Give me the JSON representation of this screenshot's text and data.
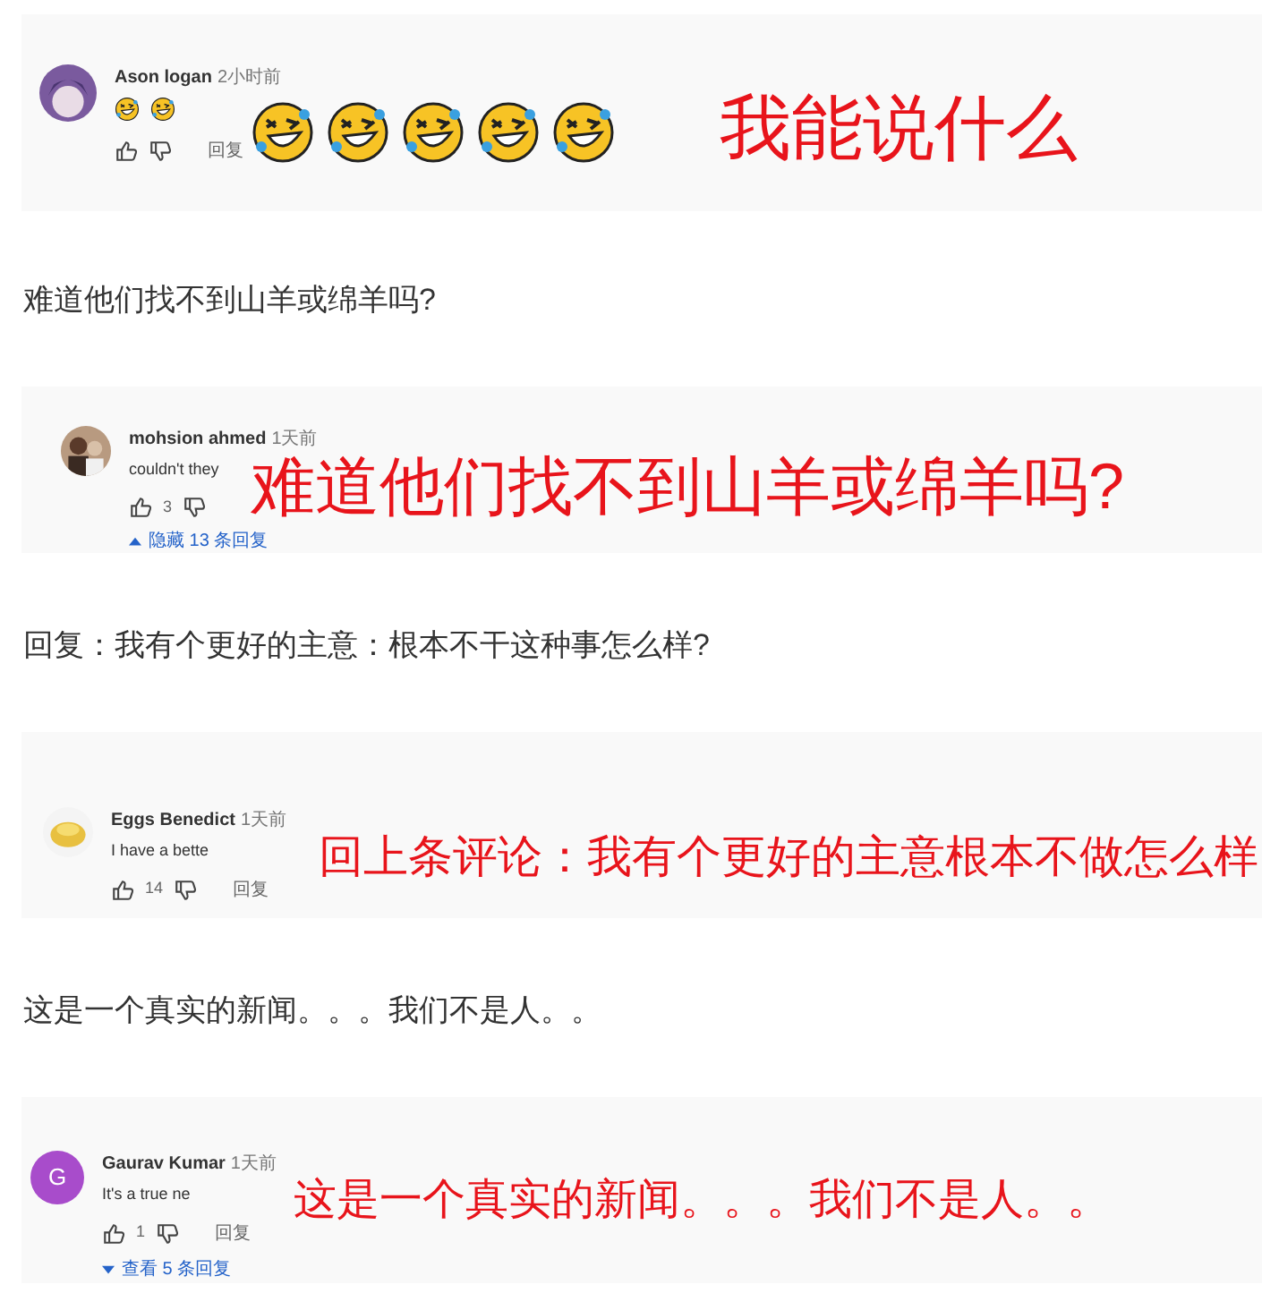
{
  "blocks": [
    {
      "kind": "comment_shot",
      "author": "Ason logan",
      "time": "2小时前",
      "body": {
        "kind": "emoji"
      },
      "reply_label": "回复",
      "caption": "我能说什么"
    },
    {
      "kind": "paragraph",
      "text": "难道他们找不到山羊或绵羊吗?"
    },
    {
      "kind": "comment_shot",
      "author": "mohsion ahmed",
      "time": "1天前",
      "body": {
        "kind": "text",
        "text": "couldn't they"
      },
      "likes": "3",
      "replies": {
        "label": "隐藏 13 条回复",
        "expanded": true
      },
      "caption": "难道他们找不到山羊或绵羊吗?"
    },
    {
      "kind": "paragraph",
      "text": "回复：我有个更好的主意：根本不干这种事怎么样?"
    },
    {
      "kind": "comment_shot",
      "author": "Eggs Benedict",
      "time": "1天前",
      "body": {
        "kind": "text",
        "text": "I have a bette"
      },
      "likes": "14",
      "reply_label": "回复",
      "caption": "回上条评论：我有个更好的主意根本不做怎么样"
    },
    {
      "kind": "paragraph",
      "text": "这是一个真实的新闻。。。我们不是人。。"
    },
    {
      "kind": "comment_shot",
      "avatar": {
        "kind": "letter",
        "letter": "G"
      },
      "author": "Gaurav Kumar",
      "time": "1天前",
      "body": {
        "kind": "text",
        "text": "It's a true ne"
      },
      "likes": "1",
      "reply_label": "回复",
      "replies": {
        "label": "查看 5 条回复",
        "expanded": false
      },
      "caption": "这是一个真实的新闻。。。我们不是人。。"
    }
  ]
}
